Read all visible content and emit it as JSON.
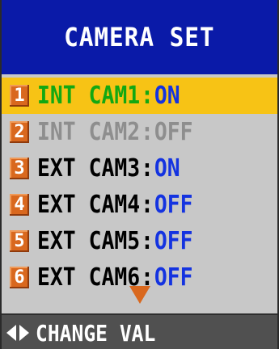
{
  "header": {
    "title": "CAMERA SET"
  },
  "menu": {
    "items": [
      {
        "number": "1",
        "prefix": "INT",
        "camera": "CAM1",
        "value": "ON",
        "state": "selected"
      },
      {
        "number": "2",
        "prefix": "INT",
        "camera": "CAM2",
        "value": "OFF",
        "state": "disabled"
      },
      {
        "number": "3",
        "prefix": "EXT",
        "camera": "CAM3",
        "value": "ON",
        "state": "normal"
      },
      {
        "number": "4",
        "prefix": "EXT",
        "camera": "CAM4",
        "value": "OFF",
        "state": "normal"
      },
      {
        "number": "5",
        "prefix": "EXT",
        "camera": "CAM5",
        "value": "OFF",
        "state": "normal"
      },
      {
        "number": "6",
        "prefix": "EXT",
        "camera": "CAM6",
        "value": "OFF",
        "state": "normal"
      }
    ],
    "more_indicator_icon": "down-triangle-icon"
  },
  "footer": {
    "hint_icons": [
      "left-arrow-icon",
      "right-arrow-icon"
    ],
    "hint_text": "CHANGE VAL"
  },
  "colors": {
    "header_bg": "#0a1aa8",
    "menu_bg": "#c8c8c8",
    "selected_bg": "#f7c315",
    "selected_text": "#12a812",
    "disabled_text": "#8e8e8e",
    "value_text": "#1433e0",
    "number_badge": "#d9681e",
    "footer_bg": "#505050"
  }
}
